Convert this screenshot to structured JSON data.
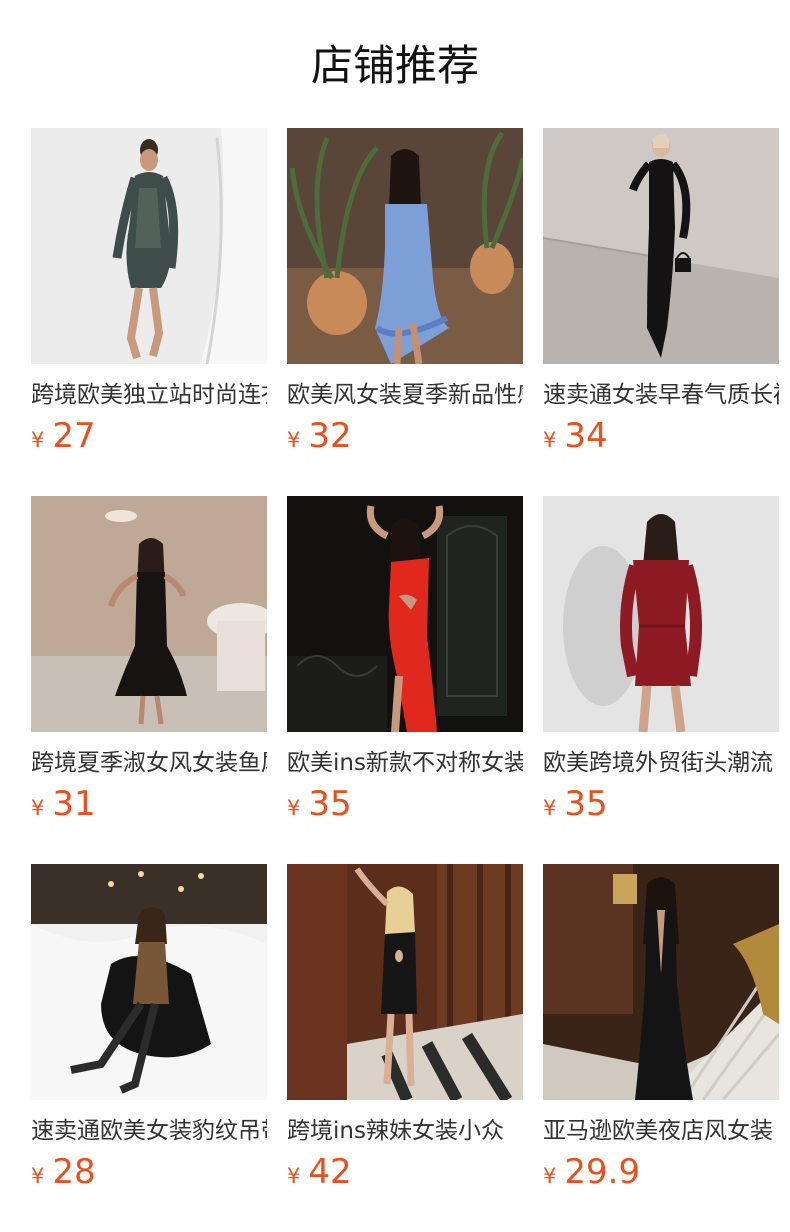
{
  "section": {
    "title": "店铺推荐"
  },
  "products": [
    {
      "name": "跨境欧美独立站时尚连衣裙",
      "currency": "¥",
      "price": "27",
      "image": "model-leopard-mesh-dress"
    },
    {
      "name": "欧美风女装夏季新品性感抹胸",
      "currency": "¥",
      "price": "32",
      "image": "model-blue-strapless-dress"
    },
    {
      "name": "速卖通女装早春气质长裙",
      "currency": "¥",
      "price": "34",
      "image": "model-black-long-gown"
    },
    {
      "name": "跨境夏季淑女风女装鱼尾裙",
      "currency": "¥",
      "price": "31",
      "image": "model-black-mermaid-dress"
    },
    {
      "name": "欧美ins新款不对称女装",
      "currency": "¥",
      "price": "35",
      "image": "model-red-cutout-dress"
    },
    {
      "name": "欧美跨境外贸街头潮流",
      "currency": "¥",
      "price": "35",
      "image": "model-burgundy-mini-dress"
    },
    {
      "name": "速卖通欧美女装豹纹吊带",
      "currency": "¥",
      "price": "28",
      "image": "model-leopard-slip-dress-snow"
    },
    {
      "name": "跨境ins辣妹女装小众",
      "currency": "¥",
      "price": "42",
      "image": "model-black-strapless-mini"
    },
    {
      "name": "亚马逊欧美夜店风女装",
      "currency": "¥",
      "price": "29.9",
      "image": "model-black-halter-jumpsuit"
    }
  ],
  "colors": {
    "price": "#e8501f",
    "title": "#111111",
    "name": "#333333"
  }
}
